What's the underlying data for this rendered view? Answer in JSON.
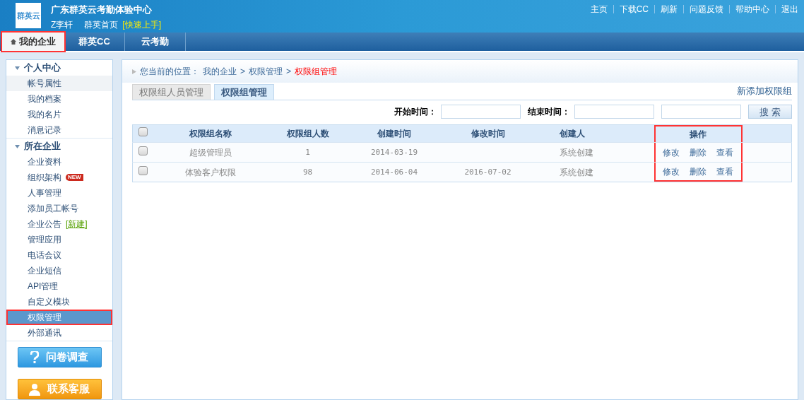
{
  "header": {
    "logo_text": "群英云",
    "title": "广东群英云考勤体验中心",
    "user": "Z李轩",
    "home_link": "群英首页",
    "quick_start": "[快速上手]",
    "top_links": [
      "主页",
      "下载CC",
      "刷新",
      "问题反馈",
      "帮助中心",
      "退出"
    ]
  },
  "nav_tabs": [
    {
      "label": "我的企业",
      "selected": true,
      "highlighted": true
    },
    {
      "label": "群英CC",
      "selected": false,
      "highlighted": false
    },
    {
      "label": "云考勤",
      "selected": false,
      "highlighted": false
    }
  ],
  "sidebar": {
    "sections": [
      {
        "title": "个人中心",
        "expanded": true,
        "children": [
          {
            "label": "帐号属性",
            "selected": false,
            "hovered": true,
            "highlighted": false
          },
          {
            "label": "我的档案",
            "selected": false,
            "hovered": false,
            "highlighted": false
          },
          {
            "label": "我的名片",
            "selected": false,
            "hovered": false,
            "highlighted": false
          },
          {
            "label": "消息记录",
            "selected": false,
            "hovered": false,
            "highlighted": false
          }
        ]
      },
      {
        "title": "所在企业",
        "expanded": true,
        "children": [
          {
            "label": "企业资料",
            "selected": false,
            "hovered": false,
            "highlighted": false
          },
          {
            "label": "组织架构",
            "selected": false,
            "hovered": false,
            "highlighted": false,
            "badge": "NEW"
          },
          {
            "label": "人事管理",
            "selected": false,
            "hovered": false,
            "highlighted": false
          },
          {
            "label": "添加员工帐号",
            "selected": false,
            "hovered": false,
            "highlighted": false
          },
          {
            "label": "企业公告",
            "selected": false,
            "hovered": false,
            "highlighted": false,
            "link": "[新建]"
          },
          {
            "label": "管理应用",
            "selected": false,
            "hovered": false,
            "highlighted": false
          },
          {
            "label": "电话会议",
            "selected": false,
            "hovered": false,
            "highlighted": false
          },
          {
            "label": "企业短信",
            "selected": false,
            "hovered": false,
            "highlighted": false
          },
          {
            "label": "API管理",
            "selected": false,
            "hovered": false,
            "highlighted": false
          },
          {
            "label": "自定义模块",
            "selected": false,
            "hovered": false,
            "highlighted": false
          },
          {
            "label": "权限管理",
            "selected": true,
            "hovered": false,
            "highlighted": true
          },
          {
            "label": "外部通讯",
            "selected": false,
            "hovered": false,
            "highlighted": false
          }
        ]
      }
    ],
    "buttons": [
      {
        "kind": "survey",
        "label": "问卷调查"
      },
      {
        "kind": "service",
        "label": "联系客服"
      }
    ]
  },
  "breadcrumb": {
    "prefix": "您当前的位置：",
    "items": [
      "我的企业",
      "权限管理"
    ],
    "current": "权限组管理",
    "separator": ">"
  },
  "tabs": [
    {
      "label": "权限组人员管理",
      "selected": false
    },
    {
      "label": "权限组管理",
      "selected": true
    }
  ],
  "add_link": "新添加权限组",
  "filter": {
    "start_label": "开始时间：",
    "end_label": "结束时间：",
    "search_button": "搜 索"
  },
  "table": {
    "columns": [
      "权限组名称",
      "权限组人数",
      "创建时间",
      "修改时间",
      "创建人",
      "操作"
    ],
    "actions_highlighted": true,
    "header_checked": false,
    "rows": [
      {
        "checked": false,
        "cells": [
          "超级管理员",
          "1",
          "2014-03-19",
          "",
          "系统创建"
        ],
        "actions": [
          "修改",
          "删除",
          "查看"
        ]
      },
      {
        "checked": false,
        "cells": [
          "体验客户权限",
          "98",
          "2014-06-04",
          "2016-07-02",
          "系统创建"
        ],
        "actions": [
          "修改",
          "删除",
          "查看"
        ]
      }
    ]
  }
}
